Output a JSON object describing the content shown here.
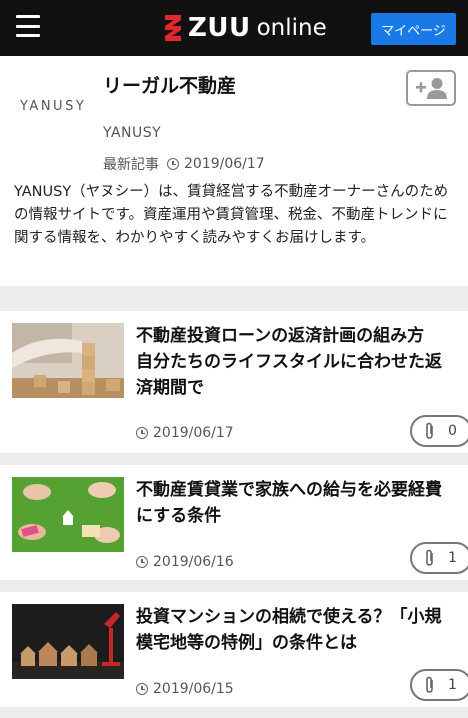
{
  "header": {
    "logo_text": "ZUU",
    "logo_sub": "online",
    "mypage_label": "マイページ"
  },
  "profile": {
    "logo_text": "YANUSY",
    "name": "リーガル不動産",
    "sub_name": "YANUSY",
    "latest_label": "最新記事",
    "latest_date": "2019/06/17",
    "description": "YANUSY（ヤヌシー）は、賃貸経営する不動産オーナーさんのための情報サイトです。資産運用や賃貸管理、税金、不動産トレンドに関する情報を、わかりやすく読みやすくお届けします。"
  },
  "articles": [
    {
      "title": "不動産投資ローンの返済計画の組み方　自分たちのライフスタイルに合わせた返済期間で",
      "date": "2019/06/17",
      "clip_count": "0"
    },
    {
      "title": "不動産賃貸業で家族への給与を必要経費にする条件",
      "date": "2019/06/16",
      "clip_count": "1"
    },
    {
      "title": "投資マンションの相続で使える？「小規模宅地等の特例」の条件とは",
      "date": "2019/06/15",
      "clip_count": "1"
    }
  ],
  "colors": {
    "header_bg": "#111111",
    "mypage_bg": "#1979e6",
    "logo_red": "#e4262f"
  }
}
